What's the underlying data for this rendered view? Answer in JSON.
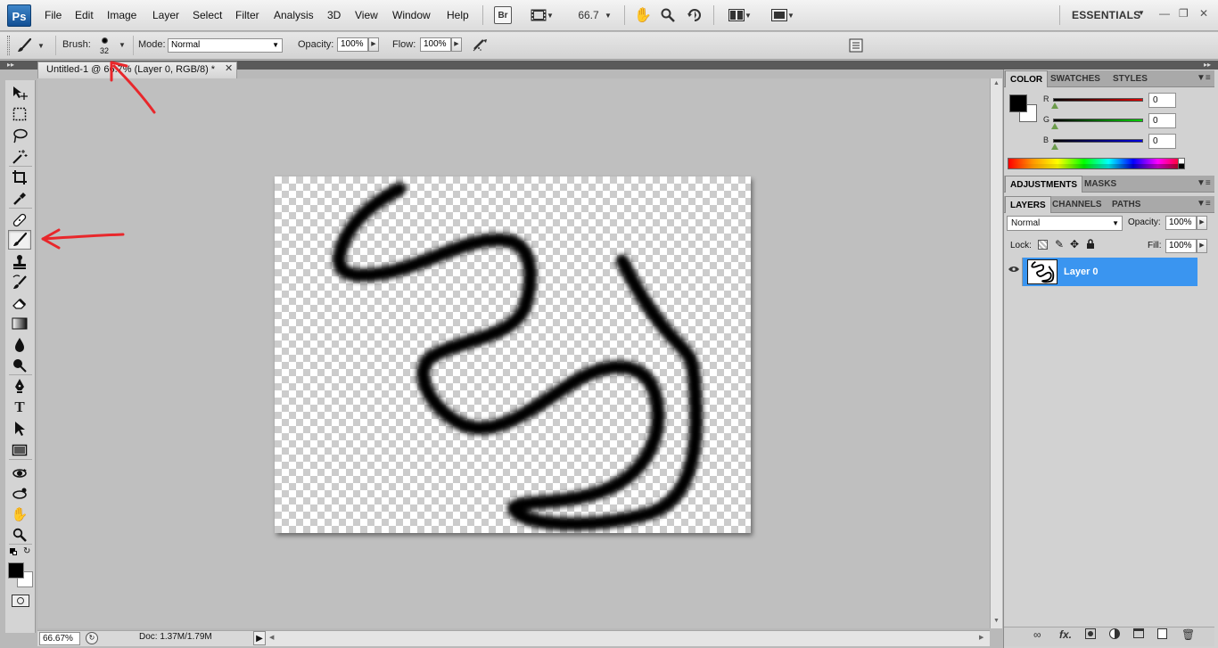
{
  "app": {
    "logo": "Ps",
    "menu": [
      "File",
      "Edit",
      "Image",
      "Layer",
      "Select",
      "Filter",
      "Analysis",
      "3D",
      "View",
      "Window",
      "Help"
    ],
    "bridge_label": "Br",
    "zoom_value": "66.7",
    "workspace": "ESSENTIALS"
  },
  "options_bar": {
    "brush_label": "Brush:",
    "brush_size": "32",
    "mode_label": "Mode:",
    "mode_value": "Normal",
    "opacity_label": "Opacity:",
    "opacity_value": "100%",
    "flow_label": "Flow:",
    "flow_value": "100%"
  },
  "document": {
    "tab_title": "Untitled-1 @ 66.7% (Layer 0, RGB/8) *",
    "zoom_status": "66.67%",
    "doc_size": "Doc: 1.37M/1.79M"
  },
  "panels": {
    "color_tabs": [
      "COLOR",
      "SWATCHES",
      "STYLES"
    ],
    "channels": [
      {
        "label": "R",
        "value": "0",
        "color": "#e00000"
      },
      {
        "label": "G",
        "value": "0",
        "color": "#00d000"
      },
      {
        "label": "B",
        "value": "0",
        "color": "#0000e0"
      }
    ],
    "adjustments_tabs": [
      "ADJUSTMENTS",
      "MASKS"
    ],
    "layers_tabs": [
      "LAYERS",
      "CHANNELS",
      "PATHS"
    ],
    "blend_mode": "Normal",
    "opacity_label": "Opacity:",
    "opacity_value": "100%",
    "lock_label": "Lock:",
    "fill_label": "Fill:",
    "fill_value": "100%",
    "layer_name": "Layer 0"
  },
  "colors": {
    "accent": "#3a95f0",
    "annotation": "#e8272b",
    "foreground": "#000000",
    "background": "#ffffff"
  },
  "tools": [
    "move-icon",
    "marquee-icon",
    "lasso-icon",
    "magic-wand-icon",
    "crop-icon",
    "eyedropper-icon",
    "healing-brush-icon",
    "brush-icon",
    "clone-stamp-icon",
    "history-brush-icon",
    "eraser-icon",
    "gradient-icon",
    "blur-icon",
    "dodge-icon",
    "pen-icon",
    "type-icon",
    "path-selection-icon",
    "shape-icon",
    "3d-rotate-icon",
    "3d-orbit-icon",
    "hand-icon",
    "zoom-icon"
  ]
}
